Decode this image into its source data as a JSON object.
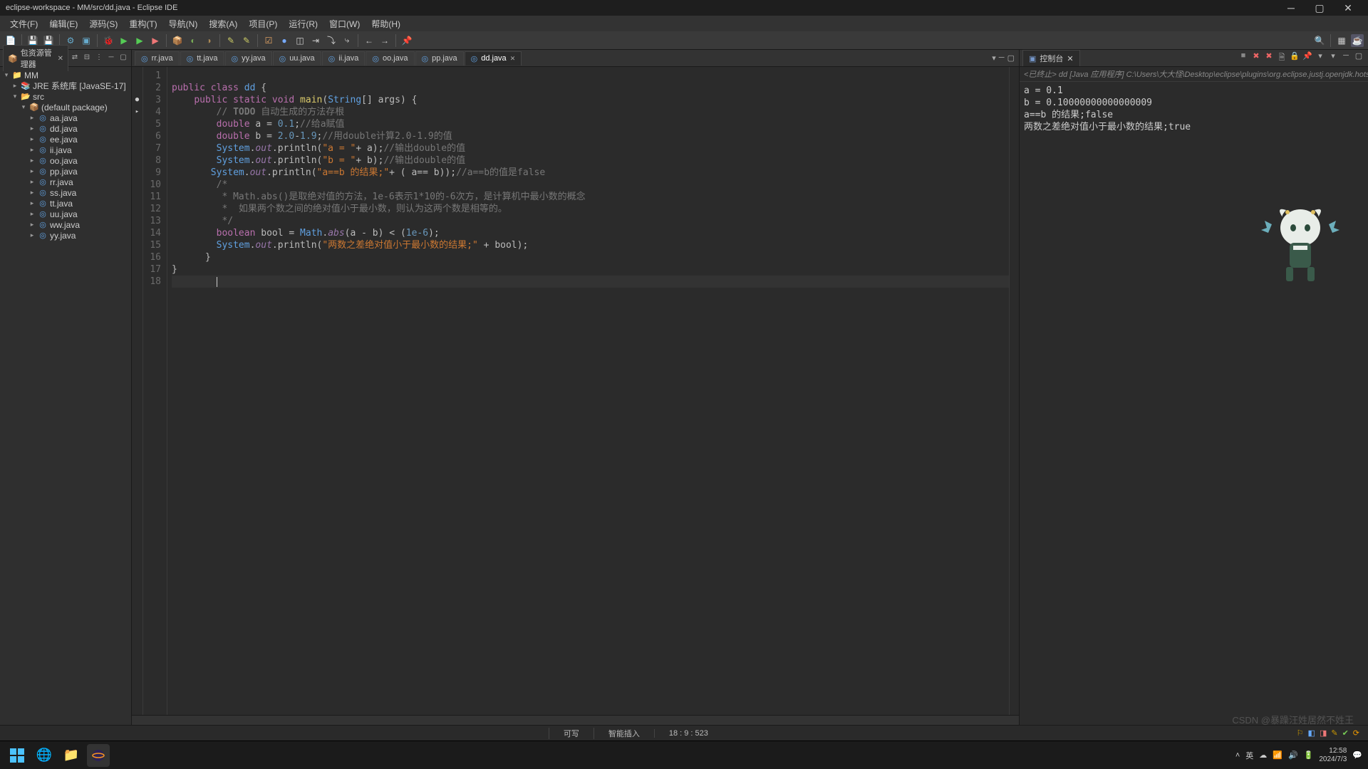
{
  "window": {
    "title": "eclipse-workspace - MM/src/dd.java - Eclipse IDE"
  },
  "menu": [
    "文件(F)",
    "编辑(E)",
    "源码(S)",
    "重构(T)",
    "导航(N)",
    "搜索(A)",
    "项目(P)",
    "运行(R)",
    "窗口(W)",
    "帮助(H)"
  ],
  "package_explorer": {
    "label": "包资源管理器",
    "project": "MM",
    "jre": "JRE 系统库 [JavaSE-17]",
    "src": "src",
    "default_package": "(default package)",
    "files": [
      "aa.java",
      "dd.java",
      "ee.java",
      "ii.java",
      "oo.java",
      "pp.java",
      "rr.java",
      "ss.java",
      "tt.java",
      "uu.java",
      "ww.java",
      "yy.java"
    ]
  },
  "editor_tabs": [
    "rr.java",
    "tt.java",
    "yy.java",
    "uu.java",
    "ii.java",
    "oo.java",
    "pp.java",
    "dd.java"
  ],
  "code_lines": [
    {
      "n": 1,
      "html": ""
    },
    {
      "n": 2,
      "html": "<span class='kw'>public</span> <span class='kw'>class</span> <span class='cls'>dd</span> {"
    },
    {
      "n": 3,
      "html": "    <span class='kw'>public</span> <span class='kw'>static</span> <span class='kw'>void</span> <span class='mth'>main</span>(<span class='cls'>String</span>[] args) {",
      "mark": "●"
    },
    {
      "n": 4,
      "html": "        <span class='cmt'>// <b>TODO</b> 自动生成的方法存根</span>",
      "mark": "▸"
    },
    {
      "n": 5,
      "html": "        <span class='kw'>double</span> a = <span class='num'>0.1</span>;<span class='cmt'>//给a赋值</span>"
    },
    {
      "n": 6,
      "html": "        <span class='kw'>double</span> b = <span class='num'>2.0</span>-<span class='num'>1.9</span>;<span class='cmt'>//用double计算2.0-1.9的值</span>"
    },
    {
      "n": 7,
      "html": "        <span class='cls'>System</span>.<span class='fld'>out</span>.println(<span class='str'>\"a = \"</span>+ a);<span class='cmt'>//输出double的值</span>"
    },
    {
      "n": 8,
      "html": "        <span class='cls'>System</span>.<span class='fld'>out</span>.println(<span class='str'>\"b = \"</span>+ b);<span class='cmt'>//输出double的值</span>"
    },
    {
      "n": 9,
      "html": "       <span class='cls'>System</span>.<span class='fld'>out</span>.println(<span class='str'>\"a==b 的结果;\"</span>+ ( a== b));<span class='cmt'>//a==b的值是false</span>"
    },
    {
      "n": 10,
      "html": "        <span class='cmt'>/*</span>"
    },
    {
      "n": 11,
      "html": "        <span class='cmt'> * Math.abs()是取绝对值的方法，1e-6表示1*10的-6次方，是计算机中最小数的概念</span>"
    },
    {
      "n": 12,
      "html": "        <span class='cmt'> *  如果两个数之间的绝对值小于最小数，则认为这两个数是相等的。</span>"
    },
    {
      "n": 13,
      "html": "        <span class='cmt'> */</span>"
    },
    {
      "n": 14,
      "html": "        <span class='kw'>boolean</span> bool = <span class='cls'>Math</span>.<span class='fld'>abs</span>(a - b) &lt; (<span class='num'>1e-6</span>);"
    },
    {
      "n": 15,
      "html": "        <span class='cls'>System</span>.<span class='fld'>out</span>.println(<span class='str'>\"两数之差绝对值小于最小数的结果;\"</span> + bool);"
    },
    {
      "n": 16,
      "html": "      }"
    },
    {
      "n": 17,
      "html": "}"
    },
    {
      "n": 18,
      "html": "        <span class='cursor'></span>",
      "sel": true
    }
  ],
  "console": {
    "label": "控制台",
    "header": "<已终止> dd [Java 应用程序] C:\\Users\\大大怪\\Desktop\\eclipse\\plugins\\org.eclipse.justj.openjdk.hotspot.jre.full",
    "lines": [
      "a = 0.1",
      "b = 0.10000000000000009",
      "a==b 的结果;false",
      "两数之差绝对值小于最小数的结果;true"
    ]
  },
  "status": {
    "writable": "可写",
    "insert": "智能插入",
    "pos": "18 : 9 : 523"
  },
  "taskbar": {
    "time": "12:58",
    "date": "2024/7/3",
    "watermark": "CSDN @暴躁汪姓居然不姓王"
  }
}
